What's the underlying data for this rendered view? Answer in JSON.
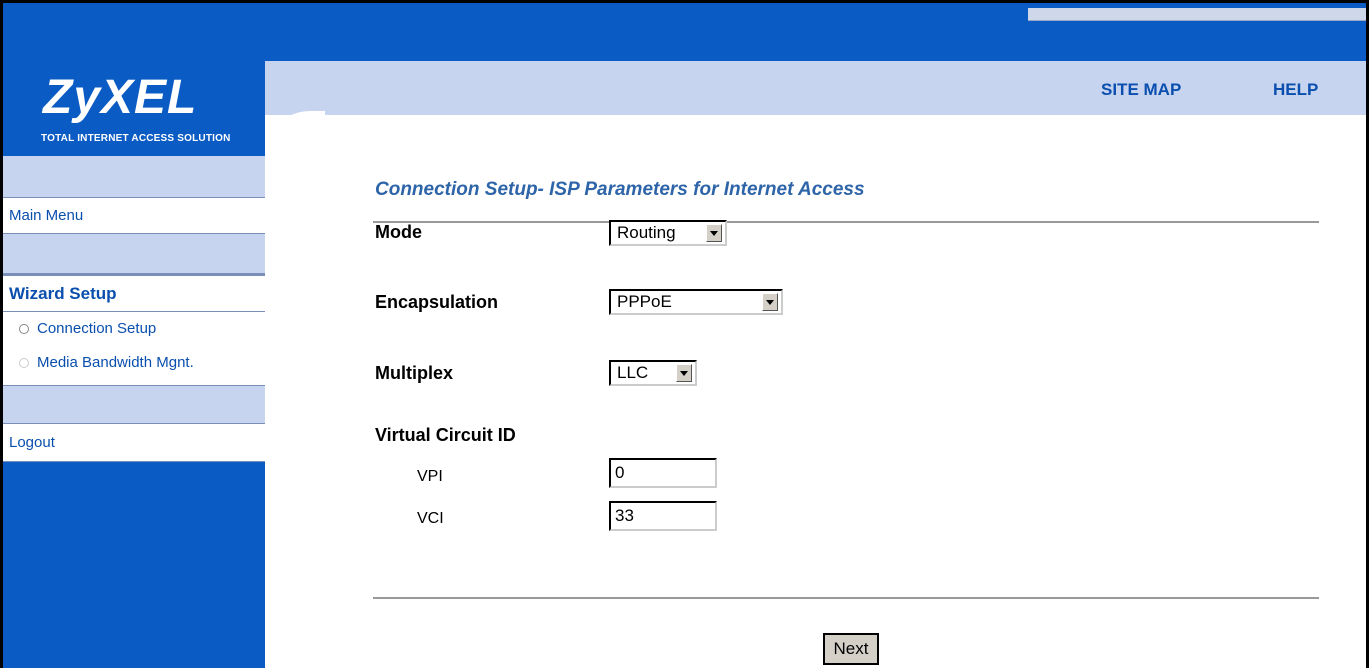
{
  "brand": {
    "logo": "ZyXEL",
    "tagline": "TOTAL INTERNET ACCESS SOLUTION"
  },
  "header": {
    "site_map": "SITE MAP",
    "help": "HELP"
  },
  "sidebar": {
    "main_menu": "Main Menu",
    "wizard_setup": "Wizard Setup",
    "connection_setup": "Connection Setup",
    "media_bandwidth": "Media Bandwidth Mgnt.",
    "logout": "Logout"
  },
  "page": {
    "title": "Connection Setup- ISP Parameters for Internet Access",
    "mode_label": "Mode",
    "mode_value": "Routing",
    "encapsulation_label": "Encapsulation",
    "encapsulation_value": "PPPoE",
    "multiplex_label": "Multiplex",
    "multiplex_value": "LLC",
    "vc_label": "Virtual Circuit ID",
    "vpi_label": "VPI",
    "vpi_value": "0",
    "vci_label": "VCI",
    "vci_value": "33",
    "next_label": "Next"
  },
  "colors": {
    "primary_blue": "#0a5cc4",
    "light_band": "#c7d4f0",
    "link_blue": "#0a4fae",
    "title_blue": "#2e64a8"
  }
}
